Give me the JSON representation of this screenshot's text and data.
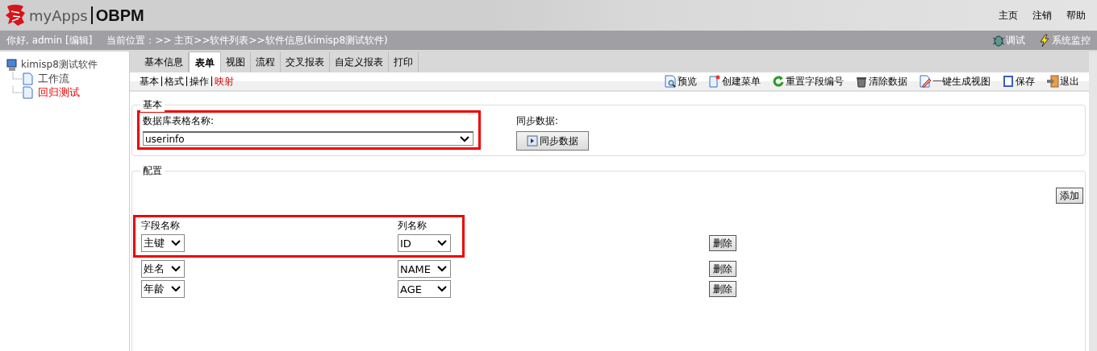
{
  "header": {
    "logo": "myApps",
    "product": "OBPM",
    "links": [
      "主页",
      "注销",
      "帮助"
    ]
  },
  "status_bar": {
    "greeting": "你好, admin [编辑]",
    "breadcrumb": "当前位置：>> 主页>>软件列表>>软件信息(kimisp8测试软件)",
    "tools": [
      {
        "kind": "bug",
        "label": "调试"
      },
      {
        "kind": "bolt",
        "label": "系统监控"
      }
    ]
  },
  "sidebar": {
    "root": "kimisp8测试软件",
    "children": [
      {
        "label": "工作流",
        "selected": false
      },
      {
        "label": "回归测试",
        "selected": true
      }
    ]
  },
  "tabs": [
    {
      "label": "基本信息",
      "selected": false
    },
    {
      "label": "表单",
      "selected": true
    },
    {
      "label": "视图",
      "selected": false
    },
    {
      "label": "流程",
      "selected": false
    },
    {
      "label": "交叉报表",
      "selected": false
    },
    {
      "label": "自定义报表",
      "selected": false
    },
    {
      "label": "打印",
      "selected": false
    }
  ],
  "subtabs": [
    {
      "label": "基本",
      "selected": false
    },
    {
      "label": "格式",
      "selected": false
    },
    {
      "label": "操作",
      "selected": false
    },
    {
      "label": "映射",
      "selected": true
    }
  ],
  "toolbar": [
    {
      "kind": "preview",
      "label": "预览"
    },
    {
      "kind": "new",
      "label": "创建菜单"
    },
    {
      "kind": "reset",
      "label": "重置字段编号"
    },
    {
      "kind": "trash",
      "label": "清除数据"
    },
    {
      "kind": "edit",
      "label": "一键生成视图"
    },
    {
      "kind": "save",
      "label": "保存"
    },
    {
      "kind": "exit",
      "label": "退出"
    }
  ],
  "basic": {
    "legend": "基本",
    "table_label": "数据库表格名称:",
    "table_value": "userinfo",
    "highlighted": true,
    "sync_label": "同步数据:",
    "sync_button": "同步数据"
  },
  "config": {
    "legend": "配置",
    "add_button": "添加",
    "field_header": "字段名称",
    "column_header": "列名称",
    "rows": [
      {
        "field": "主键",
        "column": "ID",
        "delete": "删除",
        "highlighted": true
      },
      {
        "field": "姓名",
        "column": "NAME",
        "delete": "删除",
        "highlighted": false
      },
      {
        "field": "年龄",
        "column": "AGE",
        "delete": "删除",
        "highlighted": false
      }
    ]
  }
}
